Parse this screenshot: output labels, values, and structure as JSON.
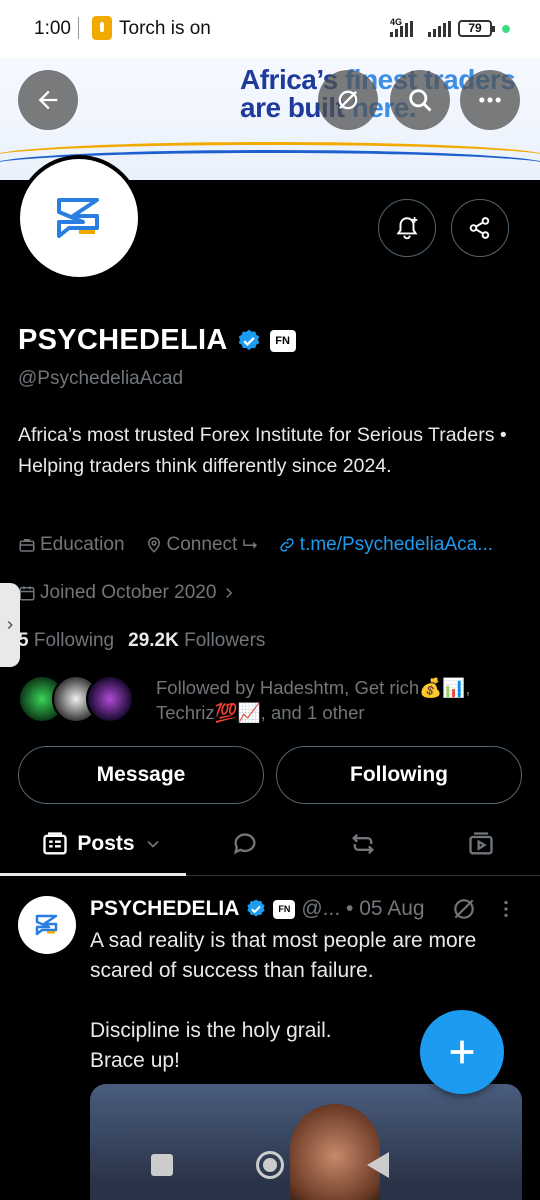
{
  "status_bar": {
    "time": "1:00",
    "torch_text": "Torch is on",
    "network_label": "4G",
    "battery": "79"
  },
  "banner": {
    "tagline_part1": "Africa’s ",
    "tagline_highlight1": "finest traders",
    "tagline_part2": "are built ",
    "tagline_highlight2": "here."
  },
  "profile": {
    "name": "PSYCHEDELIA",
    "affiliate_badge": "FN",
    "handle": "@PsychedeliaAcad",
    "bio": "Africa’s most trusted Forex Institute for Serious Traders • Helping traders think differently since 2024.",
    "category": "Education",
    "location": "Connect ⮡",
    "link": "t.me/PsychedeliaAca...",
    "joined": "Joined October 2020",
    "following_count": "5",
    "following_label": "Following",
    "followers_count": "29.2K",
    "followers_label": "Followers",
    "followed_by": "Followed by Hadeshtm, Get rich💰📊, Techriz💯📈, and 1 other"
  },
  "actions": {
    "message": "Message",
    "following": "Following"
  },
  "tabs": {
    "posts": "Posts"
  },
  "post": {
    "name": "PSYCHEDELIA",
    "affiliate_badge": "FN",
    "handle_date": "@... • 05 Aug",
    "text": "A sad reality is that most people are more scared of success than failure.\n\nDiscipline is the holy grail.\nBrace up!"
  },
  "colors": {
    "accent": "#1d9bf0",
    "background": "#000000",
    "muted": "#71767b"
  }
}
